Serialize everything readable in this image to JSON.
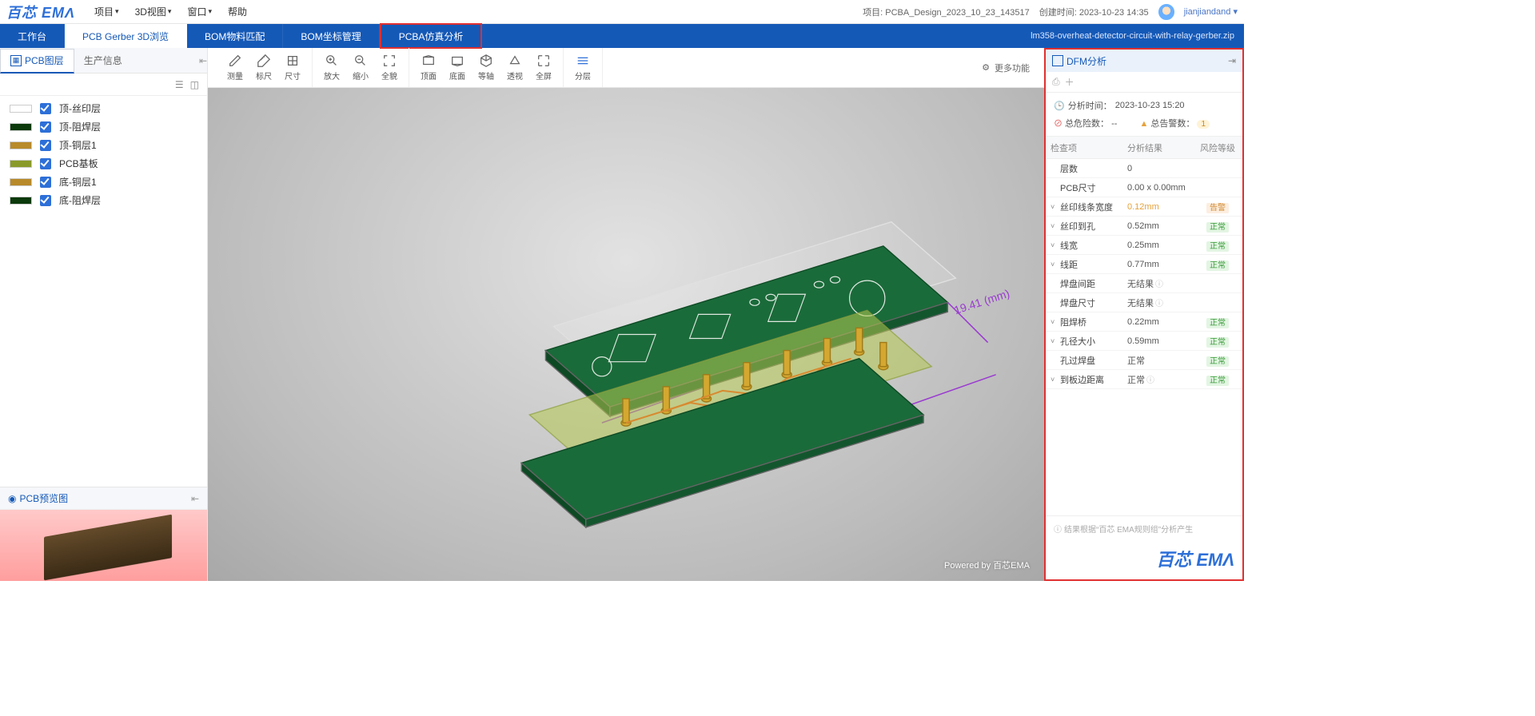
{
  "logo": "百芯 EMΛ",
  "menu": [
    "项目",
    "3D视图",
    "窗口",
    "帮助"
  ],
  "top_right": {
    "proj_label": "项目:",
    "proj_name": "PCBA_Design_2023_10_23_143517",
    "created_label": "创建时间:",
    "created_time": "2023-10-23 14:35",
    "user": "jianjiandand"
  },
  "tabs": [
    "工作台",
    "PCB Gerber 3D浏览",
    "BOM物料匹配",
    "BOM坐标管理",
    "PCBA仿真分析"
  ],
  "active_tab": 1,
  "file_name": "lm358-overheat-detector-circuit-with-relay-gerber.zip",
  "left": {
    "tabs": [
      "PCB图层",
      "生产信息"
    ],
    "active": 0,
    "layers": [
      {
        "color": "#ffffff",
        "label": "顶-丝印层"
      },
      {
        "color": "#0c3a0c",
        "label": "顶-阻焊层"
      },
      {
        "color": "#b88a2a",
        "label": "顶-铜层1"
      },
      {
        "color": "#8a9a2a",
        "label": "PCB基板"
      },
      {
        "color": "#b88a2a",
        "label": "底-铜层1"
      },
      {
        "color": "#0c3a0c",
        "label": "底-阻焊层"
      }
    ],
    "preview_title": "PCB预览图"
  },
  "tools": {
    "g1": [
      {
        "name": "measure",
        "label": "测量"
      },
      {
        "name": "ruler",
        "label": "标尺"
      },
      {
        "name": "size",
        "label": "尺寸"
      }
    ],
    "g2": [
      {
        "name": "zoom-in",
        "label": "放大"
      },
      {
        "name": "zoom-out",
        "label": "缩小"
      },
      {
        "name": "fit",
        "label": "全貌"
      }
    ],
    "g3": [
      {
        "name": "top",
        "label": "顶面"
      },
      {
        "name": "bottom",
        "label": "底面"
      },
      {
        "name": "iso",
        "label": "等轴"
      },
      {
        "name": "persp",
        "label": "透视"
      },
      {
        "name": "full",
        "label": "全屏"
      }
    ],
    "g4": [
      {
        "name": "explode",
        "label": "分层"
      }
    ],
    "more": "更多功能"
  },
  "credit": "Powered by 百芯EMA",
  "dfm": {
    "title": "DFM分析",
    "time_label": "分析时间：",
    "time": "2023-10-23 15:20",
    "risk_label": "总危险数：",
    "risk_count": "--",
    "warn_label": "总告警数：",
    "warn_count": "1",
    "cols": [
      "检查项",
      "分析结果",
      "风险等级"
    ],
    "rows": [
      {
        "exp": "",
        "name": "层数",
        "result": "0",
        "tag": ""
      },
      {
        "exp": "",
        "name": "PCB尺寸",
        "result": "0.00 x 0.00mm",
        "tag": ""
      },
      {
        "exp": "v",
        "name": "丝印线条宽度",
        "result": "0.12mm",
        "tag": "告警",
        "warn": true
      },
      {
        "exp": "v",
        "name": "丝印到孔",
        "result": "0.52mm",
        "tag": "正常"
      },
      {
        "exp": "v",
        "name": "线宽",
        "result": "0.25mm",
        "tag": "正常"
      },
      {
        "exp": "v",
        "name": "线距",
        "result": "0.77mm",
        "tag": "正常"
      },
      {
        "exp": "",
        "name": "焊盘间距",
        "result": "无结果",
        "tag": "",
        "info": true
      },
      {
        "exp": "",
        "name": "焊盘尺寸",
        "result": "无结果",
        "tag": "",
        "info": true
      },
      {
        "exp": "v",
        "name": "阻焊桥",
        "result": "0.22mm",
        "tag": "正常"
      },
      {
        "exp": "v",
        "name": "孔径大小",
        "result": "0.59mm",
        "tag": "正常"
      },
      {
        "exp": "",
        "name": "孔过焊盘",
        "result": "正常",
        "tag": "正常"
      },
      {
        "exp": "v",
        "name": "到板边距离",
        "result": "正常",
        "tag": "正常",
        "info": true
      }
    ],
    "foot": "结果根据“百芯 EMA规则组”分析产生",
    "logo": "百芯 EMΛ"
  }
}
